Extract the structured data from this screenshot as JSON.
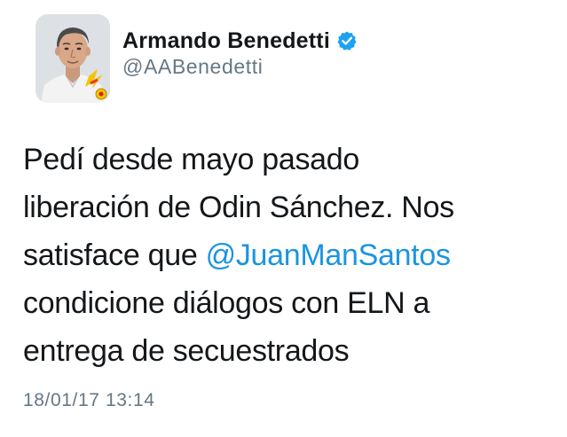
{
  "tweet": {
    "author": {
      "display_name": "Armando Benedetti",
      "handle": "@AABenedetti",
      "verified": true,
      "avatar_icon": "profile-photo"
    },
    "text_lines": [
      {
        "before": "Pedí desde mayo pasado",
        "mention": "",
        "after": ""
      },
      {
        "before": "liberación de Odin Sánchez. Nos",
        "mention": "",
        "after": ""
      },
      {
        "before": "satisface que ",
        "mention": "@JuanManSantos",
        "after": ""
      },
      {
        "before": "condicione diálogos con ELN a",
        "mention": "",
        "after": ""
      },
      {
        "before": "entrega de secuestrados",
        "mention": "",
        "after": ""
      }
    ],
    "timestamp": "18/01/17 13:14"
  },
  "colors": {
    "text": "#14171a",
    "secondary": "#657786",
    "link": "#1b95e0",
    "verified_badge": "#1da1f2"
  }
}
